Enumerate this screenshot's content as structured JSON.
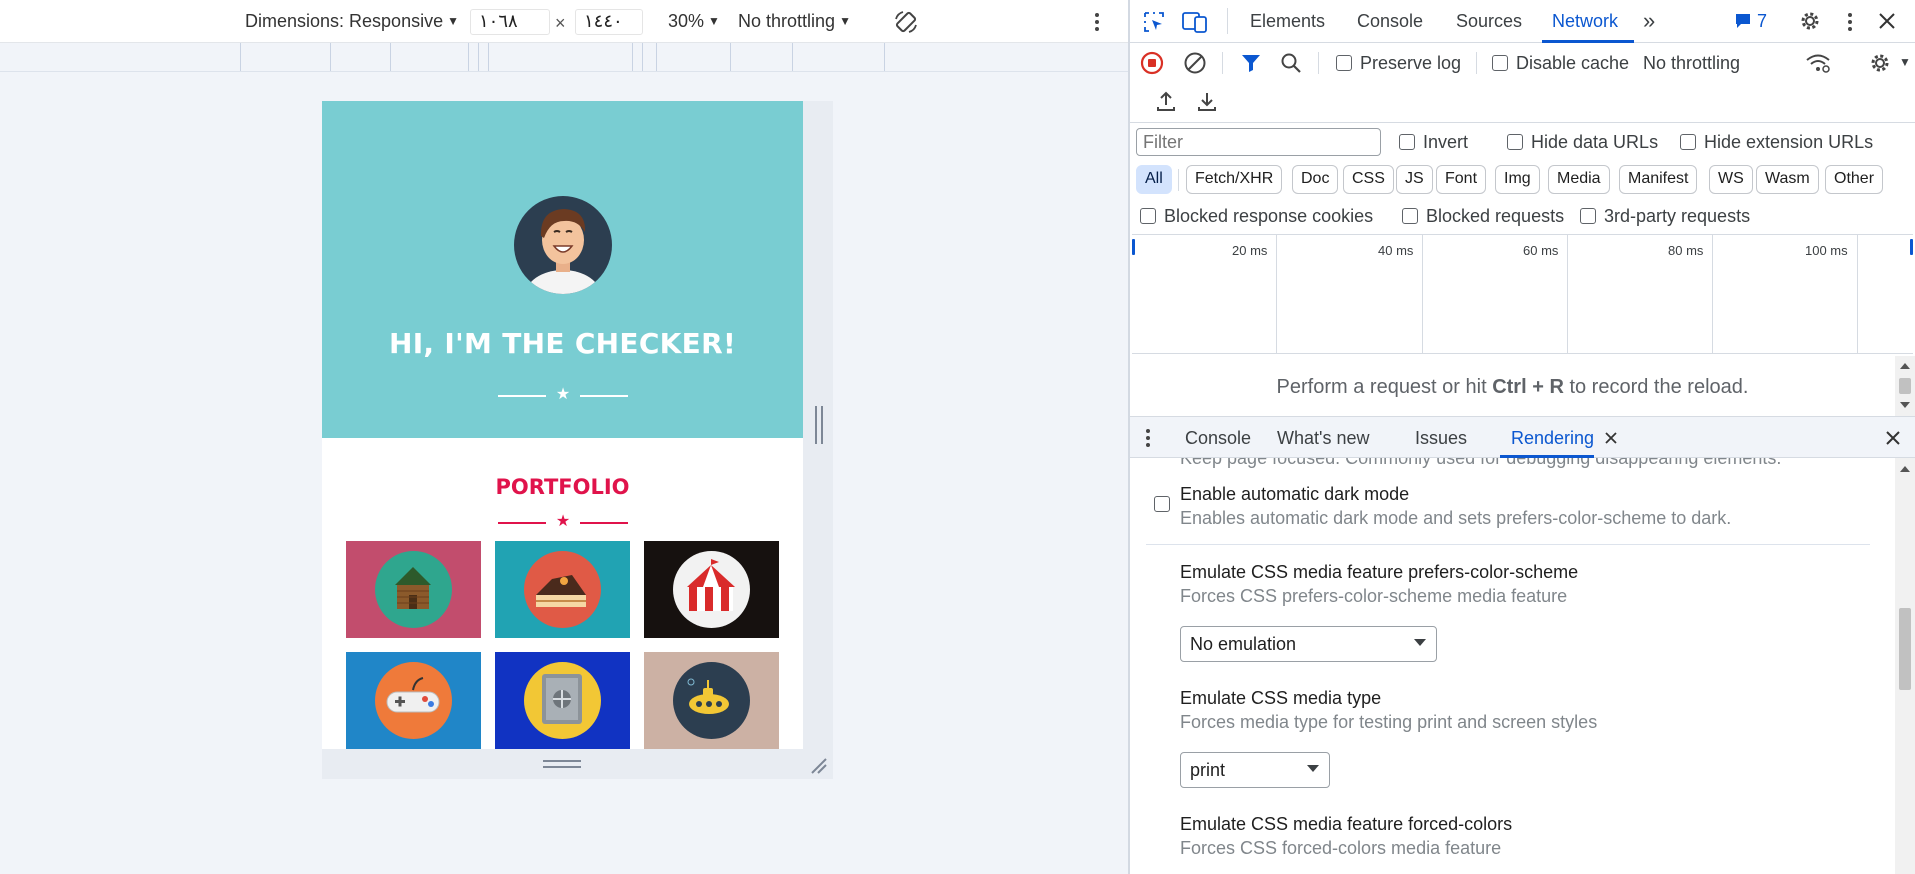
{
  "device_toolbar": {
    "dimensions_label": "Dimensions: Responsive",
    "width_value": "١٠٦٨",
    "height_value": "١٤٤٠",
    "times_symbol": "×",
    "zoom_label": "30%",
    "throttle_label": "No throttling"
  },
  "emulated_page": {
    "hero_title": "HI, I'M THE CHECKER!",
    "portfolio_title": "PORTFOLIO",
    "colors": {
      "hero_bg": "#79cdd2",
      "accent": "#e0134b",
      "tiles": [
        "#c24d6d",
        "#21a3b3",
        "#16110f",
        "#2086c8",
        "#1133c2",
        "#ccb1a4"
      ],
      "circles": [
        "#2fa68e",
        "#e05a46",
        "#f2f2f2",
        "#ef7a3a",
        "#f2c735",
        "#2c3e50"
      ]
    },
    "tiles": [
      {
        "icon": "cabin-icon"
      },
      {
        "icon": "cake-icon"
      },
      {
        "icon": "circus-tent-icon"
      },
      {
        "icon": "game-controller-icon"
      },
      {
        "icon": "safe-icon"
      },
      {
        "icon": "submarine-icon"
      }
    ]
  },
  "devtools": {
    "tabs": [
      "Elements",
      "Console",
      "Sources",
      "Network"
    ],
    "active_tab": "Network",
    "issues_count": "7",
    "network_toolbar": {
      "preserve_log": "Preserve log",
      "disable_cache": "Disable cache",
      "throttle": "No throttling"
    },
    "filter": {
      "placeholder": "Filter",
      "invert": "Invert",
      "hide_data_urls": "Hide data URLs",
      "hide_extension_urls": "Hide extension URLs"
    },
    "type_filters": [
      "All",
      "Fetch/XHR",
      "Doc",
      "CSS",
      "JS",
      "Font",
      "Img",
      "Media",
      "Manifest",
      "WS",
      "Wasm",
      "Other"
    ],
    "active_type_filter": "All",
    "blocked_response_cookies": "Blocked response cookies",
    "blocked_requests": "Blocked requests",
    "third_party_requests": "3rd-party requests",
    "timeline_ticks": [
      "20 ms",
      "40 ms",
      "60 ms",
      "80 ms",
      "100 ms"
    ],
    "empty_message": {
      "before": "Perform a request or hit ",
      "shortcut": "Ctrl + R",
      "after": " to record the reload."
    },
    "drawer": {
      "tabs": [
        "Console",
        "What's new",
        "Issues",
        "Rendering"
      ],
      "active_tab": "Rendering",
      "partial_line": "Keep page focused. Commonly used for debugging disappearing elements.",
      "options": [
        {
          "title": "Enable automatic dark mode",
          "desc": "Enables automatic dark mode and sets prefers-color-scheme to dark."
        },
        {
          "title": "Emulate CSS media feature prefers-color-scheme",
          "desc": "Forces CSS prefers-color-scheme media feature",
          "select": "No emulation"
        },
        {
          "title": "Emulate CSS media type",
          "desc": "Forces media type for testing print and screen styles",
          "select": "print"
        },
        {
          "title": "Emulate CSS media feature forced-colors",
          "desc": "Forces CSS forced-colors media feature"
        }
      ]
    }
  }
}
